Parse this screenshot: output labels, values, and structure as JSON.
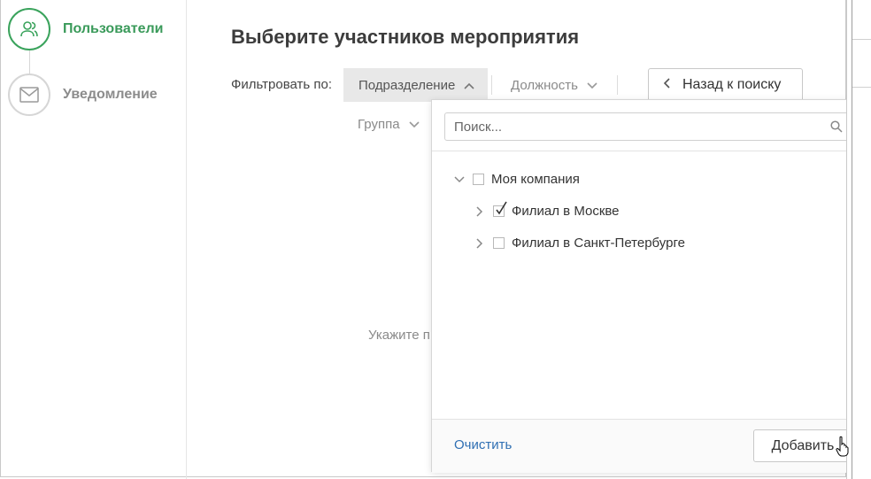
{
  "steps": [
    {
      "label": "Пользователи",
      "icon": "users-icon",
      "state": "active"
    },
    {
      "label": "Уведомление",
      "icon": "envelope-icon",
      "state": "inactive"
    }
  ],
  "main": {
    "title": "Выберите участников мероприятия",
    "filter_label": "Фильтровать по:",
    "filters": {
      "department": "Подразделение",
      "position": "Должность",
      "group": "Группа"
    },
    "back_button": "Назад к поиску",
    "hint": "Укажите п"
  },
  "dropdown": {
    "search_placeholder": "Поиск...",
    "tree": [
      {
        "label": "Моя компания",
        "expanded": true,
        "checked": false
      },
      {
        "label": "Филиал в Москве",
        "expanded": false,
        "checked": true
      },
      {
        "label": "Филиал в Санкт-Петербурге",
        "expanded": false,
        "checked": false
      }
    ],
    "clear_label": "Очистить",
    "add_label": "Добавить"
  },
  "colors": {
    "accent_green": "#3aa35c",
    "link_blue": "#2f6fb3",
    "chip_active_bg": "#e8e8e8"
  }
}
